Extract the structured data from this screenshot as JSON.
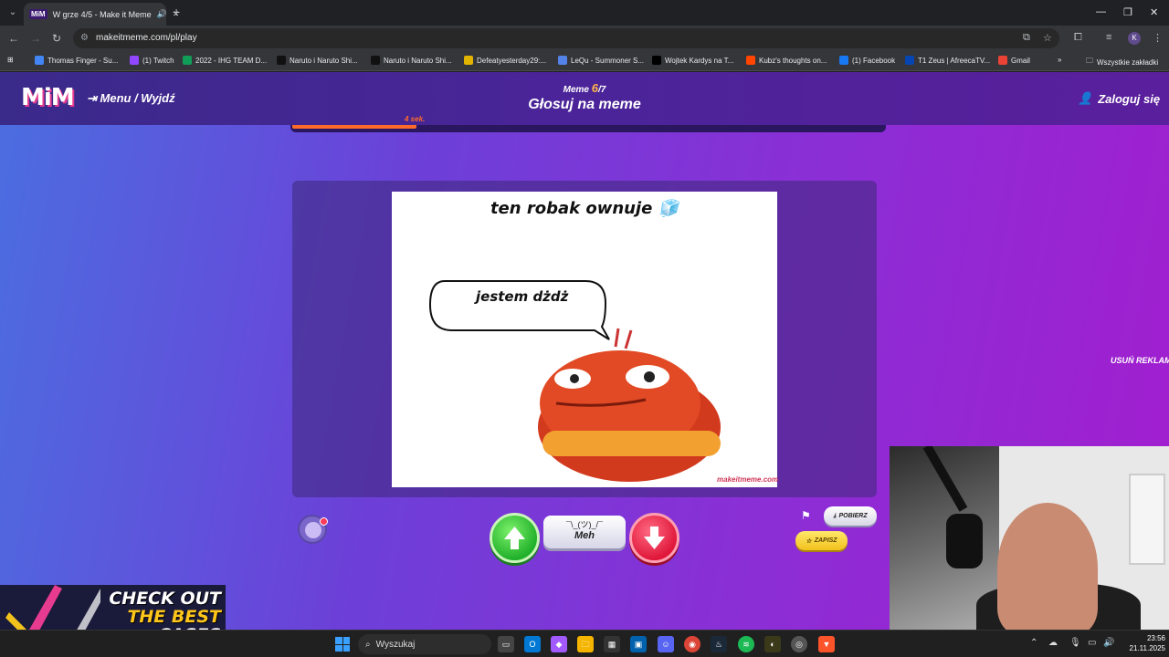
{
  "browser": {
    "tab_title": "W grze 4/5 - Make it Meme",
    "tab_favicon": "MiM",
    "url": "makeitmeme.com/pl/play",
    "profile_initial": "K",
    "bookmarks": [
      {
        "label": "Thomas Finger - Su...",
        "icon": "doc-icon",
        "color": "#4285f4"
      },
      {
        "label": "(1) Twitch",
        "icon": "twitch-icon",
        "color": "#9146ff"
      },
      {
        "label": "2022 - IHG TEAM D...",
        "icon": "sheets-icon",
        "color": "#0f9d58"
      },
      {
        "label": "Naruto i Naruto Shi...",
        "icon": "w-icon",
        "color": "#111111"
      },
      {
        "label": "Naruto i Naruto Shi...",
        "icon": "w-icon",
        "color": "#111111"
      },
      {
        "label": "Defeatyesterday29:...",
        "icon": "v-icon",
        "color": "#e0b400"
      },
      {
        "label": "LeQu - Summoner S...",
        "icon": "opgg-icon",
        "color": "#5383e8"
      },
      {
        "label": "Wojtek Kardys na T...",
        "icon": "x-icon",
        "color": "#000000"
      },
      {
        "label": "Kubz's thoughts on...",
        "icon": "reddit-icon",
        "color": "#ff4500"
      },
      {
        "label": "(1) Facebook",
        "icon": "facebook-icon",
        "color": "#1877f2"
      },
      {
        "label": "T1 Zeus | AfreecaTV...",
        "icon": "afreeca-icon",
        "color": "#0545b1"
      },
      {
        "label": "Gmail",
        "icon": "gmail-icon",
        "color": "#ea4335"
      }
    ],
    "all_bookmarks_label": "Wszystkie zakładki"
  },
  "header": {
    "logo": "MiM",
    "menu_label": "Menu / Wyjdź",
    "counter_prefix": "Meme",
    "counter_current": "6",
    "counter_total": "/7",
    "title": "Głosuj na meme",
    "login_label": "Zaloguj się"
  },
  "timer": {
    "label": "4 sek.",
    "progress": 0.21
  },
  "meme": {
    "caption": "ten robak ownuje 🧊",
    "bubble": "jestem dżdż",
    "watermark": "makeitmeme.com"
  },
  "remove_ads": "USUŃ REKLAMY",
  "voting": {
    "meh_shrug": "¯\\_(ツ)_/¯",
    "meh_label": "Meh",
    "download_label": "POBIERZ",
    "save_label": "ZAPISZ"
  },
  "ad": {
    "line1": "CHECK OUT",
    "line2": "THE BEST",
    "line3": "CASES"
  },
  "taskbar": {
    "search_placeholder": "Wyszukaj",
    "time": "23:56",
    "date": "21.11.2025"
  }
}
